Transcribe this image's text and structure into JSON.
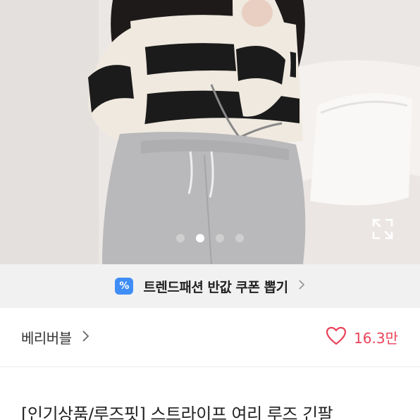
{
  "photo": {
    "alt_icon": "expand-icon",
    "carousel": {
      "total": 4,
      "active_index": 1
    }
  },
  "coupon": {
    "icon": "percent-coupon-icon",
    "icon_glyph": "%",
    "text": "트렌드패션 반값 쿠폰 뽑기",
    "accent": "#3f8df6"
  },
  "seller": {
    "name": "베리버블",
    "like_icon": "heart-icon",
    "like_count": "16.3만",
    "like_color": "#e9445a"
  },
  "product": {
    "title": "[인기상품/루즈핏] 스트라이프 여리 루즈 긴팔"
  }
}
